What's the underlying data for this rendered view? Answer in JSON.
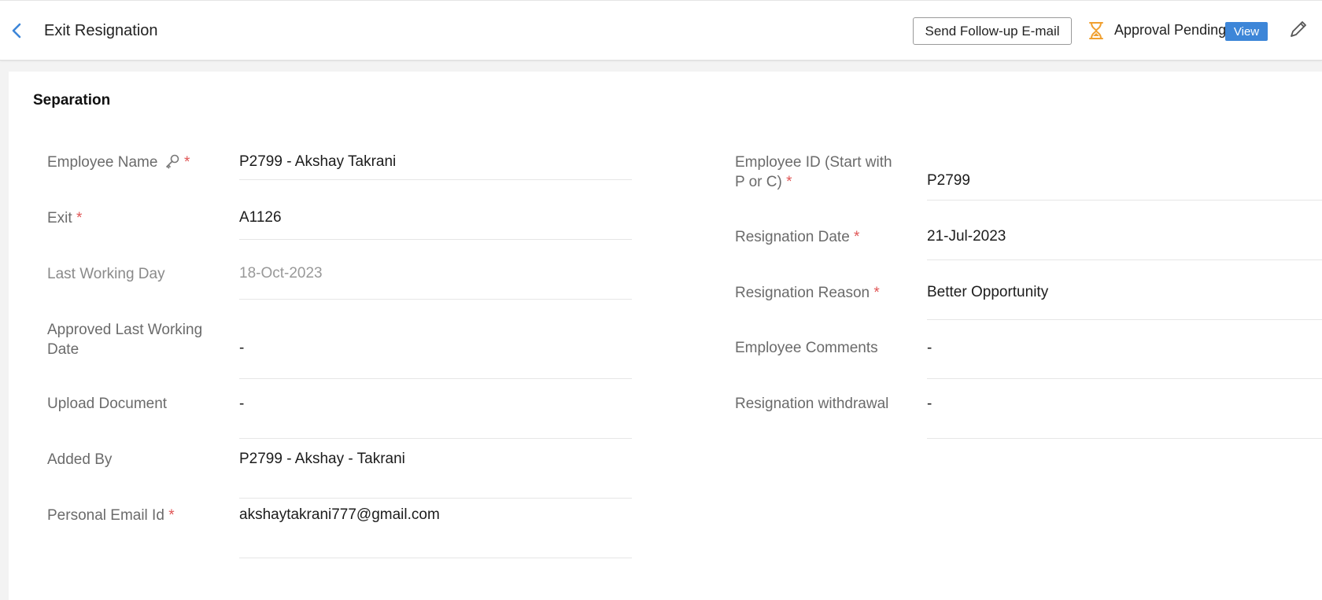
{
  "header": {
    "title": "Exit Resignation",
    "followup_label": "Send Follow-up E-mail",
    "status_text": "Approval Pending",
    "view_label": "View"
  },
  "section": {
    "title": "Separation"
  },
  "left_fields": [
    {
      "label": "Employee Name",
      "required": "*",
      "value": "P2799 - Akshay Takrani"
    },
    {
      "label": "Exit",
      "required": "*",
      "value": "A1126"
    },
    {
      "label": "Last Working Day",
      "value": "18-Oct-2023"
    },
    {
      "label_line1": "Approved Last Working",
      "label_line2": "Date",
      "value": "-"
    },
    {
      "label": "Upload Document",
      "value": "-"
    },
    {
      "label": "Added By",
      "value": "P2799 - Akshay - Takrani"
    },
    {
      "label": "Personal Email Id",
      "required": "*",
      "value": "akshaytakrani777@gmail.com"
    }
  ],
  "right_fields": [
    {
      "label_line1": "Employee ID (Start with",
      "label_line2": "P or C)",
      "required": "*",
      "value": "P2799"
    },
    {
      "label": "Resignation Date",
      "required": "*",
      "value": "21-Jul-2023"
    },
    {
      "label": "Resignation Reason",
      "required": "*",
      "value": "Better Opportunity"
    },
    {
      "label": "Employee Comments",
      "value": "-"
    },
    {
      "label": "Resignation withdrawal",
      "value": "-"
    }
  ],
  "colors": {
    "accent": "#3d86d8",
    "required": "#e05555",
    "pending": "#f0a030"
  },
  "icons": [
    "chevron-left-icon",
    "hourglass-icon",
    "pencil-icon",
    "key-icon"
  ]
}
